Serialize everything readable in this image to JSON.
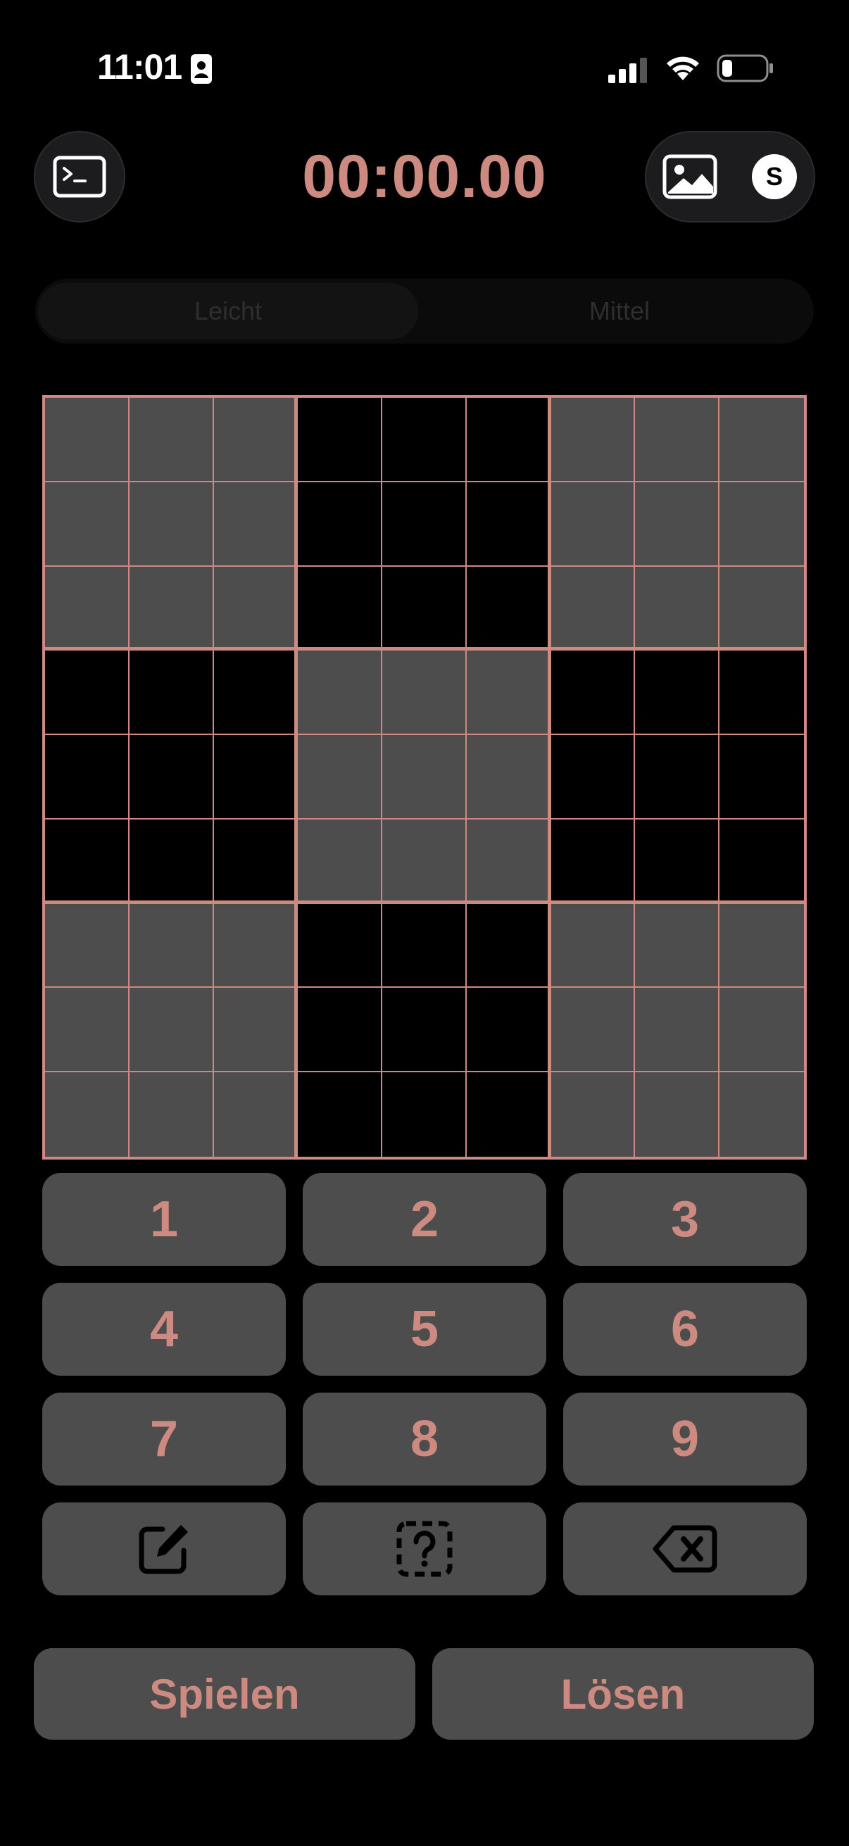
{
  "status_bar": {
    "time": "11:01",
    "icons": [
      "contact-card-icon",
      "cellular-signal-icon",
      "wifi-icon",
      "battery-icon"
    ]
  },
  "header": {
    "timer": "00:00.00",
    "left_icon": "terminal-icon",
    "right_icons": [
      "image-icon",
      "avatar"
    ],
    "avatar_initial": "S"
  },
  "difficulty": {
    "segments": [
      "Leicht",
      "Mittel"
    ],
    "selected": "Leicht"
  },
  "sudoku": {
    "cells": [
      [
        "",
        "",
        "",
        "",
        "",
        "",
        "",
        "",
        ""
      ],
      [
        "",
        "",
        "",
        "",
        "",
        "",
        "",
        "",
        ""
      ],
      [
        "",
        "",
        "",
        "",
        "",
        "",
        "",
        "",
        ""
      ],
      [
        "",
        "",
        "",
        "",
        "",
        "",
        "",
        "",
        ""
      ],
      [
        "",
        "",
        "",
        "",
        "",
        "",
        "",
        "",
        ""
      ],
      [
        "",
        "",
        "",
        "",
        "",
        "",
        "",
        "",
        ""
      ],
      [
        "",
        "",
        "",
        "",
        "",
        "",
        "",
        "",
        ""
      ],
      [
        "",
        "",
        "",
        "",
        "",
        "",
        "",
        "",
        ""
      ],
      [
        "",
        "",
        "",
        "",
        "",
        "",
        "",
        "",
        ""
      ]
    ]
  },
  "keypad": {
    "digits": [
      "1",
      "2",
      "3",
      "4",
      "5",
      "6",
      "7",
      "8",
      "9"
    ],
    "tools": [
      "pencil-edit-icon",
      "hint-question-icon",
      "delete-backspace-icon"
    ]
  },
  "actions": {
    "play_label": "Spielen",
    "solve_label": "Lösen"
  },
  "colors": {
    "accent": "#cd8a80",
    "cell_shaded": "#4d4d4d",
    "background": "#000000",
    "button": "#4d4d4d"
  }
}
